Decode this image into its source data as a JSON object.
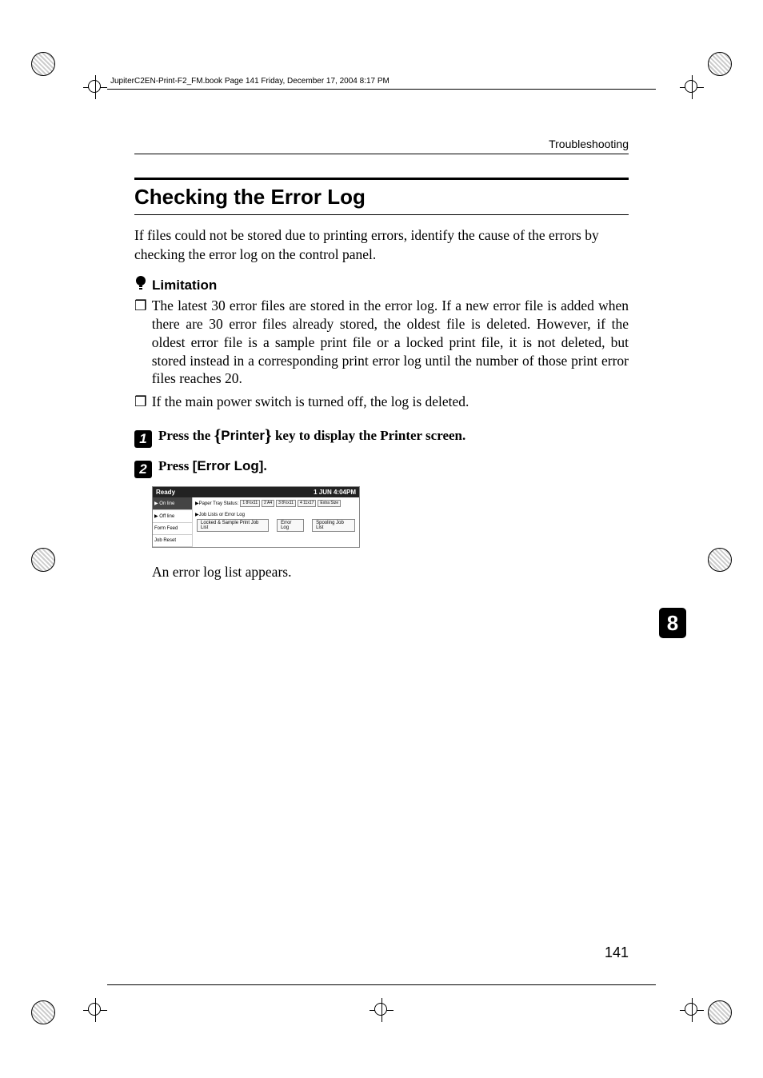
{
  "meta": {
    "book_header": "JupiterC2EN-Print-F2_FM.book  Page 141  Friday, December 17, 2004  8:17 PM"
  },
  "breadcrumb": "Troubleshooting",
  "title": "Checking the Error Log",
  "intro": "If files could not be stored due to printing errors, identify the cause of the errors by checking the error log on the control panel.",
  "limitation": {
    "label": "Limitation",
    "items": [
      "The latest 30 error files are stored in the error log. If a new error file is added when there are 30 error files already stored, the oldest file is deleted. However, if the oldest error file is a sample print file or a locked print file, it is not deleted, but stored instead in a corresponding print error log until the number of those print error files reaches 20.",
      "If the main power switch is turned off, the log is deleted."
    ]
  },
  "steps": {
    "one": {
      "prefix": "Press the ",
      "key": "Printer",
      "suffix": " key to display the Printer screen."
    },
    "two": {
      "prefix": "Press ",
      "key": "[Error Log]",
      "suffix": "."
    }
  },
  "panel": {
    "status": "Ready",
    "clock": "1 JUN   4:04PM",
    "left": {
      "online": "▶ On line",
      "offline": "▶ Off line",
      "formfeed": "Form Feed",
      "jobreset": "Job Reset"
    },
    "right": {
      "tray_label": "▶Paper Tray Status:",
      "trays": [
        "1  8½x11",
        "2  A4",
        "3  8½x11",
        "4  11x17",
        "  Extra Size"
      ],
      "joblist_label": "▶Job Lists or Error Log",
      "buttons": {
        "locked": "Locked  & Sample Print Job List",
        "errorlog": "Error Log",
        "spool": "Spooling Job List"
      }
    }
  },
  "caption": "An error log list appears.",
  "chapter_tab": "8",
  "page_number": "141",
  "glyphs": {
    "box": "❒"
  }
}
